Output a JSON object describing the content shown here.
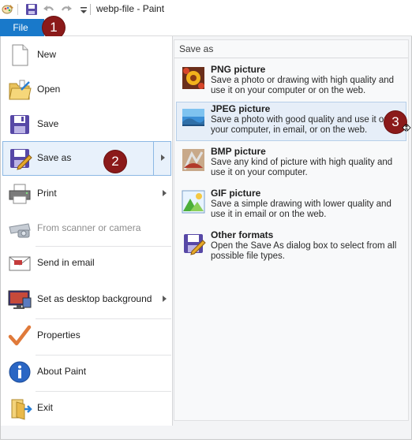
{
  "window": {
    "title": "webp-file - Paint"
  },
  "tabs": {
    "file_label": "File"
  },
  "menu": {
    "items": [
      {
        "label": "New"
      },
      {
        "label": "Open"
      },
      {
        "label": "Save"
      },
      {
        "label": "Save as"
      },
      {
        "label": "Print"
      },
      {
        "label": "From scanner or camera"
      },
      {
        "label": "Send in email"
      },
      {
        "label": "Set as desktop background"
      },
      {
        "label": "Properties"
      },
      {
        "label": "About Paint"
      },
      {
        "label": "Exit"
      }
    ]
  },
  "save_as": {
    "header": "Save as",
    "options": [
      {
        "title": "PNG picture",
        "desc": "Save a photo or drawing with high quality and use it on your computer or on the web."
      },
      {
        "title": "JPEG picture",
        "desc": "Save a photo with good quality and use it on your computer, in email, or on the web."
      },
      {
        "title": "BMP picture",
        "desc": "Save any kind of picture with high quality and use it on your computer."
      },
      {
        "title": "GIF picture",
        "desc": "Save a simple drawing with lower quality and use it in email or on the web."
      },
      {
        "title": "Other formats",
        "desc": "Open the Save As dialog box to select from all possible file types."
      }
    ]
  },
  "badges": [
    "1",
    "2",
    "3"
  ],
  "colors": {
    "accent": "#1979ca",
    "badge": "#8b1a1a",
    "selection": "#e8f1fb"
  }
}
